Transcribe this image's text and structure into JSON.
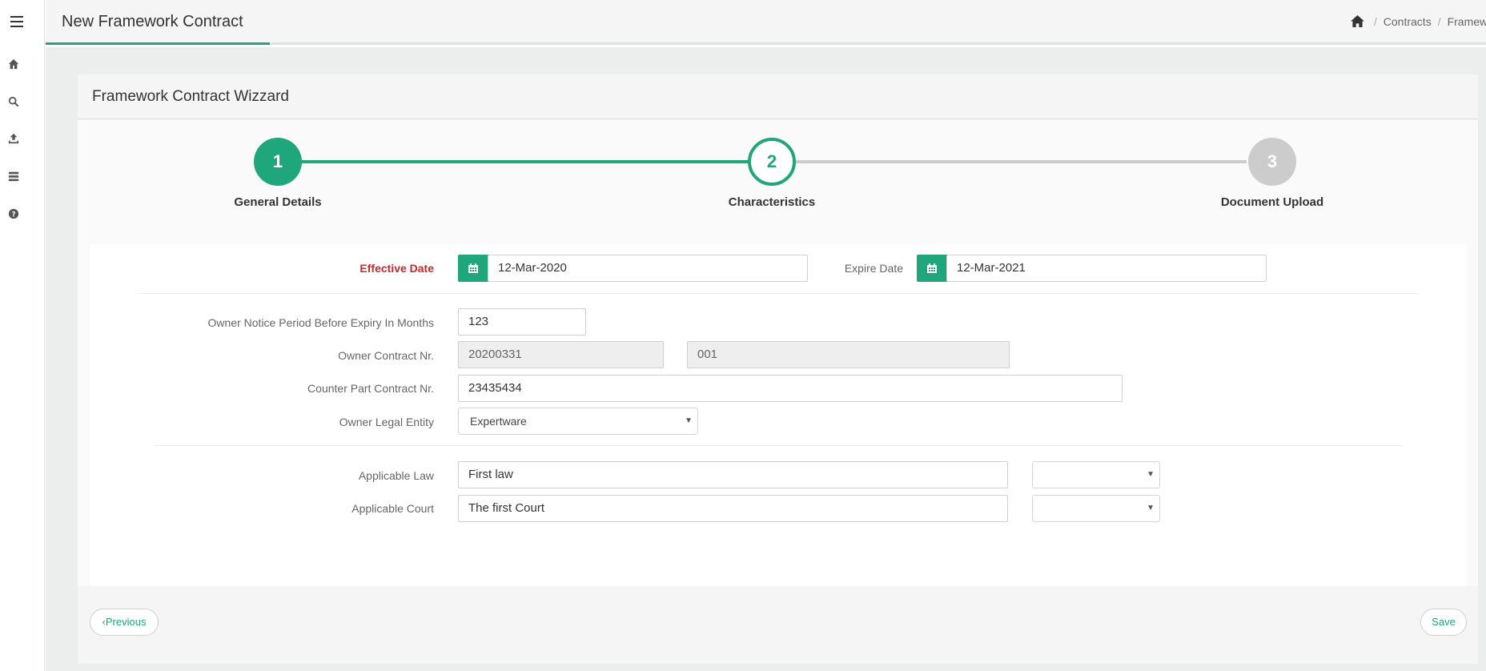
{
  "header": {
    "title": "New Framework Contract",
    "breadcrumb": {
      "item1": "Contracts",
      "item2": "Framework Con",
      "separator": "/"
    }
  },
  "sidebar": {
    "icons": [
      "home-icon",
      "search-icon",
      "upload-icon",
      "list-icon",
      "help-icon"
    ]
  },
  "wizard": {
    "title": "Framework Contract Wizzard",
    "steps": [
      {
        "number": "1",
        "label": "General Details",
        "status": "completed"
      },
      {
        "number": "2",
        "label": "Characteristics",
        "status": "active"
      },
      {
        "number": "3",
        "label": "Document Upload",
        "status": "pending"
      }
    ]
  },
  "form": {
    "effective_date": {
      "label": "Effective Date",
      "value": "12-Mar-2020"
    },
    "expire_date": {
      "label": "Expire Date",
      "value": "12-Mar-2021"
    },
    "notice_period": {
      "label": "Owner Notice Period Before Expiry In Months",
      "value": "123"
    },
    "owner_contract_nr": {
      "label": "Owner Contract Nr.",
      "value1": "20200331",
      "value2": "001"
    },
    "counter_part_contract_nr": {
      "label": "Counter Part Contract Nr.",
      "value": "23435434"
    },
    "owner_legal_entity": {
      "label": "Owner Legal Entity",
      "value": "Expertware"
    },
    "applicable_law": {
      "label": "Applicable Law",
      "value": "First law",
      "select_value": ""
    },
    "applicable_court": {
      "label": "Applicable Court",
      "value": "The first Court",
      "select_value": ""
    }
  },
  "footer": {
    "previous_label": "‹Previous",
    "save_label": "Save"
  },
  "colors": {
    "accent": "#1fa67a",
    "required": "#c62828",
    "pending_step": "#cccccc"
  }
}
